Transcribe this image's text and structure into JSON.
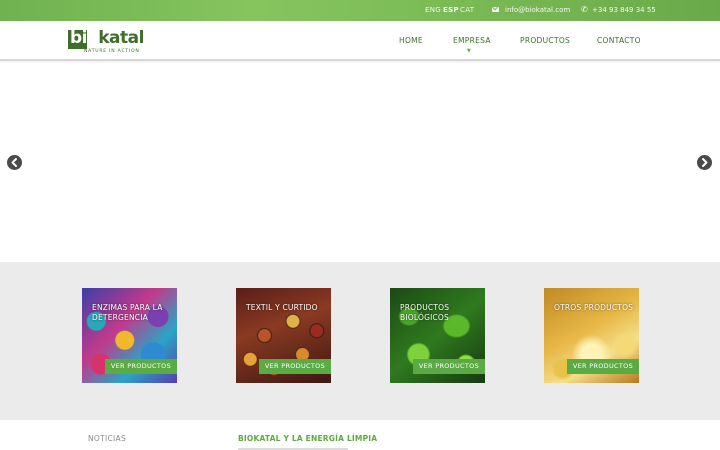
{
  "topbar": {
    "languages": [
      {
        "code": "ENG",
        "active": false
      },
      {
        "code": "ESP",
        "active": true
      },
      {
        "code": "CAT",
        "active": false
      }
    ],
    "email": "info@biokatal.com",
    "phone": "+34 93 849 34 55",
    "icons": {
      "email": "envelope-icon",
      "phone": "phone-icon"
    }
  },
  "header": {
    "logo": {
      "bio": "bio",
      "katal": "katal",
      "tagline": "NATURE IN ACTION"
    },
    "nav": [
      {
        "label": "HOME"
      },
      {
        "label": "EMPRESA",
        "has_dropdown": true
      },
      {
        "label": "PRODUCTOS"
      },
      {
        "label": "CONTACTO"
      }
    ]
  },
  "slider": {
    "prev_icon": "chevron-left-icon",
    "next_icon": "chevron-right-icon"
  },
  "products": [
    {
      "title": "ENZIMAS PARA LA DETERGENCIA",
      "button": "VER PRODUCTOS"
    },
    {
      "title": "TEXTIL Y CURTIDO",
      "button": "VER PRODUCTOS"
    },
    {
      "title": "PRODUCTOS BIOLÓGICOS",
      "button": "VER PRODUCTOS"
    },
    {
      "title": "OTROS PRODUCTOS",
      "button": "VER PRODUCTOS"
    }
  ],
  "footer": {
    "news_label": "NOTICIAS",
    "news_title": "BIOKATAL Y LA ENERGÍA LÍMPIA"
  },
  "colors": {
    "brand_green": "#3e6e2a",
    "accent_green": "#5bab44",
    "band_gray": "#ebebeb"
  }
}
